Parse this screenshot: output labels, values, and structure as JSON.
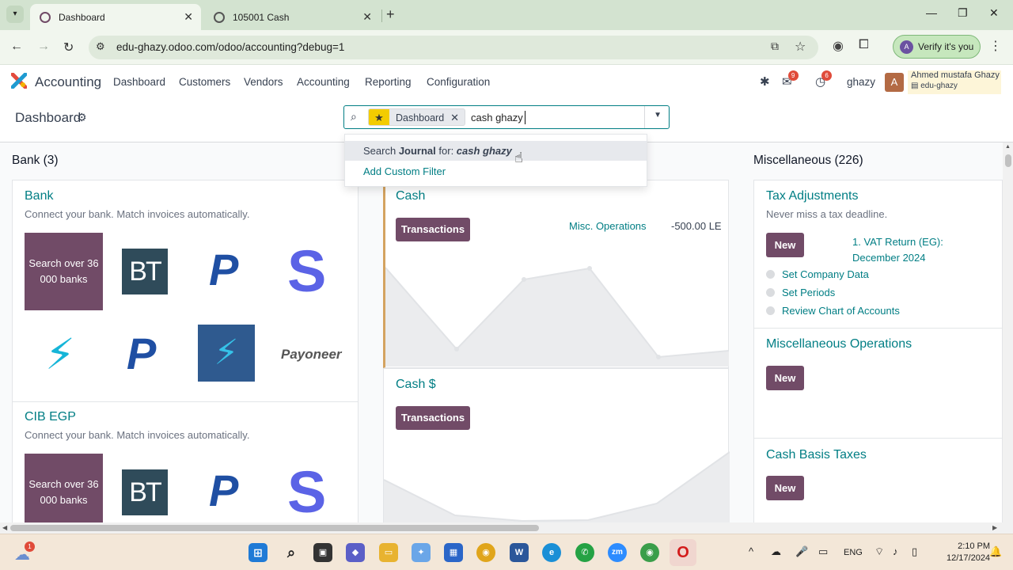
{
  "browser": {
    "tabs": [
      {
        "title": "Dashboard",
        "close": "✕"
      },
      {
        "title": "105001 Cash",
        "close": "✕"
      }
    ],
    "new_tab": "+",
    "url": "edu-ghazy.odoo.com/odoo/accounting?debug=1",
    "verify_label": "Verify it's you",
    "verify_avatar": "A"
  },
  "navbar": {
    "app_name": "Accounting",
    "menu": [
      "Dashboard",
      "Customers",
      "Vendors",
      "Accounting",
      "Reporting",
      "Configuration"
    ],
    "chat_count": "9",
    "activity_count": "6",
    "company": "ghazy",
    "avatar_letter": "A",
    "user_name": "Ahmed mustafa Ghazy",
    "database": "edu-ghazy"
  },
  "control_panel": {
    "title": "Dashboard",
    "facet_label": "Dashboard",
    "query": "cash ghazy"
  },
  "search_dropdown": {
    "prefix": "Search ",
    "field": "Journal",
    "for": " for: ",
    "term": "cash ghazy",
    "custom_filter": "Add Custom Filter"
  },
  "columns": {
    "bank": {
      "title": "Bank (3)",
      "cards": [
        {
          "name": "Bank",
          "subtitle": "Connect your bank. Match invoices automatically.",
          "search_tile": "Search over 36 000 banks"
        },
        {
          "name": "CIB EGP",
          "subtitle": "Connect your bank. Match invoices automatically.",
          "search_tile": "Search over 36 000 banks"
        }
      ],
      "logos": [
        "BT",
        "P",
        "S",
        "wise",
        "P",
        "wise",
        "Payoneer"
      ]
    },
    "cash": {
      "cards": [
        {
          "name": "Cash",
          "button": "Transactions",
          "link": "Misc. Operations",
          "amount": "-500.00 LE"
        },
        {
          "name": "Cash $",
          "button": "Transactions"
        }
      ]
    },
    "misc": {
      "title": "Miscellaneous (226)",
      "cards": [
        {
          "name": "Tax Adjustments",
          "subtitle": "Never miss a tax deadline.",
          "button": "New",
          "return_line1": "1. VAT Return (EG):",
          "return_line2": "December 2024",
          "steps": [
            "Set Company Data",
            "Set Periods",
            "Review Chart of Accounts"
          ]
        },
        {
          "name": "Miscellaneous Operations",
          "button": "New"
        },
        {
          "name": "Cash Basis Taxes",
          "button": "New"
        }
      ]
    }
  },
  "taskbar": {
    "weather_badge": "1",
    "lang": "ENG",
    "time": "2:10 PM",
    "date": "12/17/2024"
  },
  "colors": {
    "odoo_purple": "#714b67",
    "odoo_teal": "#017e84",
    "cash_accent": "#d4a360"
  }
}
